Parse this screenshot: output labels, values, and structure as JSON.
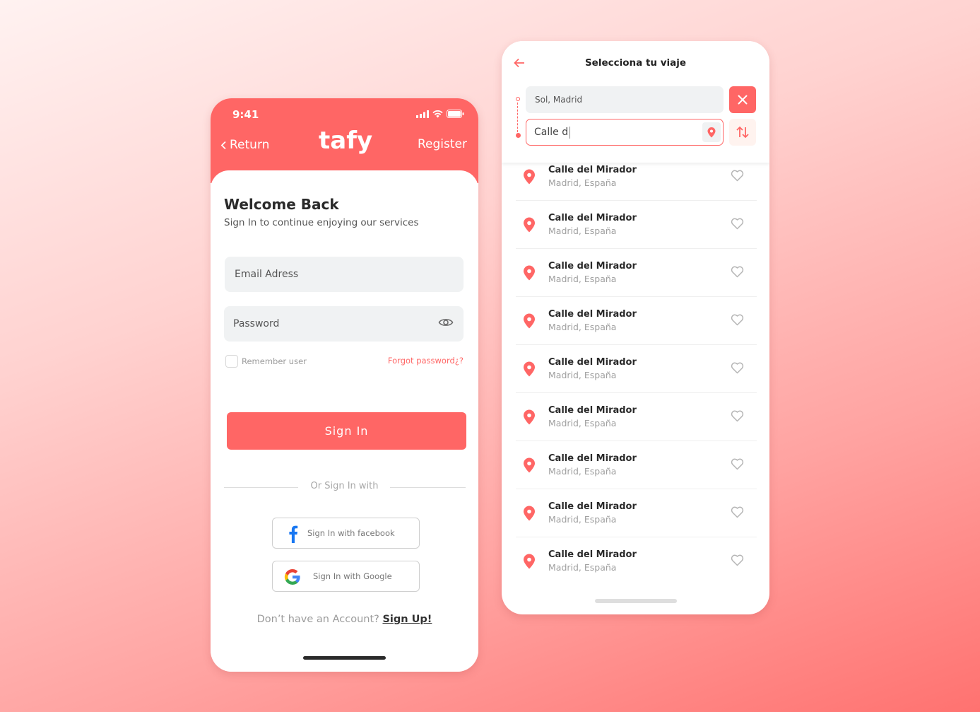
{
  "colors": {
    "accent": "#ff6665",
    "field_bg": "#f0f2f3",
    "text_dark": "#2a2a2a",
    "text_muted": "#a0a0a0"
  },
  "login": {
    "status_time": "9:41",
    "return_label": "Return",
    "brand": "tafy",
    "register_label": "Register",
    "title": "Welcome Back",
    "subtitle": "Sign In to continue enjoying our services",
    "email_placeholder": "Email Adress",
    "password_placeholder": "Password",
    "remember_label": "Remember user",
    "forgot_label": "Forgot password¿?",
    "signin_label": "Sign In",
    "or_label": "Or Sign In with",
    "facebook_label": "Sign In with facebook",
    "google_label": "Sign In with Google",
    "signup_prompt": "Don’t have an Account?",
    "signup_link": "Sign Up!"
  },
  "route": {
    "title": "Selecciona tu viaje",
    "origin_value": "Sol, Madrid",
    "destination_value": "Calle d",
    "results": [
      {
        "name": "Calle del Mirador",
        "region": "Madrid, España"
      },
      {
        "name": "Calle del Mirador",
        "region": "Madrid, España"
      },
      {
        "name": "Calle del Mirador",
        "region": "Madrid, España"
      },
      {
        "name": "Calle del Mirador",
        "region": "Madrid, España"
      },
      {
        "name": "Calle del Mirador",
        "region": "Madrid, España"
      },
      {
        "name": "Calle del Mirador",
        "region": "Madrid, España"
      },
      {
        "name": "Calle del Mirador",
        "region": "Madrid, España"
      },
      {
        "name": "Calle del Mirador",
        "region": "Madrid, España"
      },
      {
        "name": "Calle del Mirador",
        "region": "Madrid, España"
      }
    ]
  }
}
